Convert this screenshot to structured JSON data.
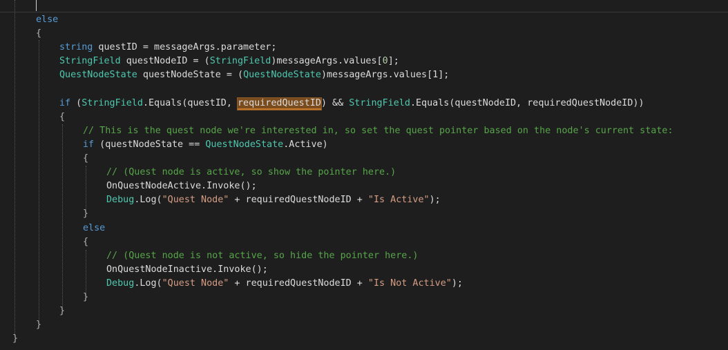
{
  "editor": {
    "lines": [
      {
        "indent": 1,
        "tokens": [
          [
            "kw",
            "else"
          ]
        ]
      },
      {
        "indent": 1,
        "tokens": [
          [
            "pn",
            "{"
          ]
        ]
      },
      {
        "indent": 2,
        "tokens": [
          [
            "kw",
            "string"
          ],
          [
            "id",
            " questID = messageArgs.parameter;"
          ]
        ]
      },
      {
        "indent": 2,
        "tokens": [
          [
            "ty",
            "StringField"
          ],
          [
            "id",
            " questNodeID = ("
          ],
          [
            "ty",
            "StringField"
          ],
          [
            "id",
            ")messageArgs.values["
          ],
          [
            "num",
            "0"
          ],
          [
            "id",
            "];"
          ]
        ]
      },
      {
        "indent": 2,
        "tokens": [
          [
            "ty",
            "QuestNodeState"
          ],
          [
            "id",
            " questNodeState = ("
          ],
          [
            "ty",
            "QuestNodeState"
          ],
          [
            "id",
            ")messageArgs.values[1];"
          ]
        ]
      },
      {
        "indent": 0,
        "tokens": []
      },
      {
        "indent": 2,
        "tokens": [
          [
            "kw",
            "if"
          ],
          [
            "id",
            " ("
          ],
          [
            "ty",
            "StringField"
          ],
          [
            "id",
            ".Equals(questID, "
          ],
          [
            "hl",
            "requiredQuestID"
          ],
          [
            "id",
            ") && "
          ],
          [
            "ty",
            "StringField"
          ],
          [
            "id",
            ".Equals(questNodeID, requiredQuestNodeID))"
          ]
        ]
      },
      {
        "indent": 2,
        "tokens": [
          [
            "pn",
            "{"
          ]
        ]
      },
      {
        "indent": 3,
        "tokens": [
          [
            "cm",
            "// This is the quest node we're interested in, so set the quest pointer based on the node's current state:"
          ]
        ]
      },
      {
        "indent": 3,
        "tokens": [
          [
            "kw",
            "if"
          ],
          [
            "id",
            " (questNodeState == "
          ],
          [
            "ty",
            "QuestNodeState"
          ],
          [
            "id",
            ".Active)"
          ]
        ]
      },
      {
        "indent": 3,
        "tokens": [
          [
            "pn",
            "{"
          ]
        ]
      },
      {
        "indent": 4,
        "tokens": [
          [
            "cm",
            "// (Quest node is active, so show the pointer here.)"
          ]
        ]
      },
      {
        "indent": 4,
        "tokens": [
          [
            "id",
            "OnQuestNodeActive.Invoke();"
          ]
        ]
      },
      {
        "indent": 4,
        "tokens": [
          [
            "ty",
            "Debug"
          ],
          [
            "id",
            ".Log("
          ],
          [
            "str",
            "\"Quest Node\""
          ],
          [
            "id",
            " + requiredQuestNodeID + "
          ],
          [
            "str",
            "\"Is Active\""
          ],
          [
            "id",
            ");"
          ]
        ]
      },
      {
        "indent": 3,
        "tokens": [
          [
            "pn",
            "}"
          ]
        ]
      },
      {
        "indent": 3,
        "tokens": [
          [
            "kw",
            "else"
          ]
        ]
      },
      {
        "indent": 3,
        "tokens": [
          [
            "pn",
            "{"
          ]
        ]
      },
      {
        "indent": 4,
        "tokens": [
          [
            "cm",
            "// (Quest node is not active, so hide the pointer here.)"
          ]
        ]
      },
      {
        "indent": 4,
        "tokens": [
          [
            "id",
            "OnQuestNodeInactive.Invoke();"
          ]
        ]
      },
      {
        "indent": 4,
        "tokens": [
          [
            "ty",
            "Debug"
          ],
          [
            "id",
            ".Log("
          ],
          [
            "str",
            "\"Quest Node\""
          ],
          [
            "id",
            " + requiredQuestNodeID + "
          ],
          [
            "str",
            "\"Is Not Active\""
          ],
          [
            "id",
            ");"
          ]
        ]
      },
      {
        "indent": 3,
        "tokens": [
          [
            "pn",
            "}"
          ]
        ]
      },
      {
        "indent": 2,
        "tokens": [
          [
            "pn",
            "}"
          ]
        ]
      },
      {
        "indent": 1,
        "tokens": [
          [
            "pn",
            "}"
          ]
        ]
      },
      {
        "indent": 0,
        "tokens": [
          [
            "pn",
            "}"
          ]
        ]
      }
    ]
  },
  "colors": {
    "background": "#1e1e1e",
    "keyword": "#569cd6",
    "type": "#4ec9b0",
    "string": "#d69d85",
    "comment": "#57a64a",
    "number": "#b5cea8",
    "identifier": "#dcdcdc",
    "highlight": "#7a4b1c"
  }
}
